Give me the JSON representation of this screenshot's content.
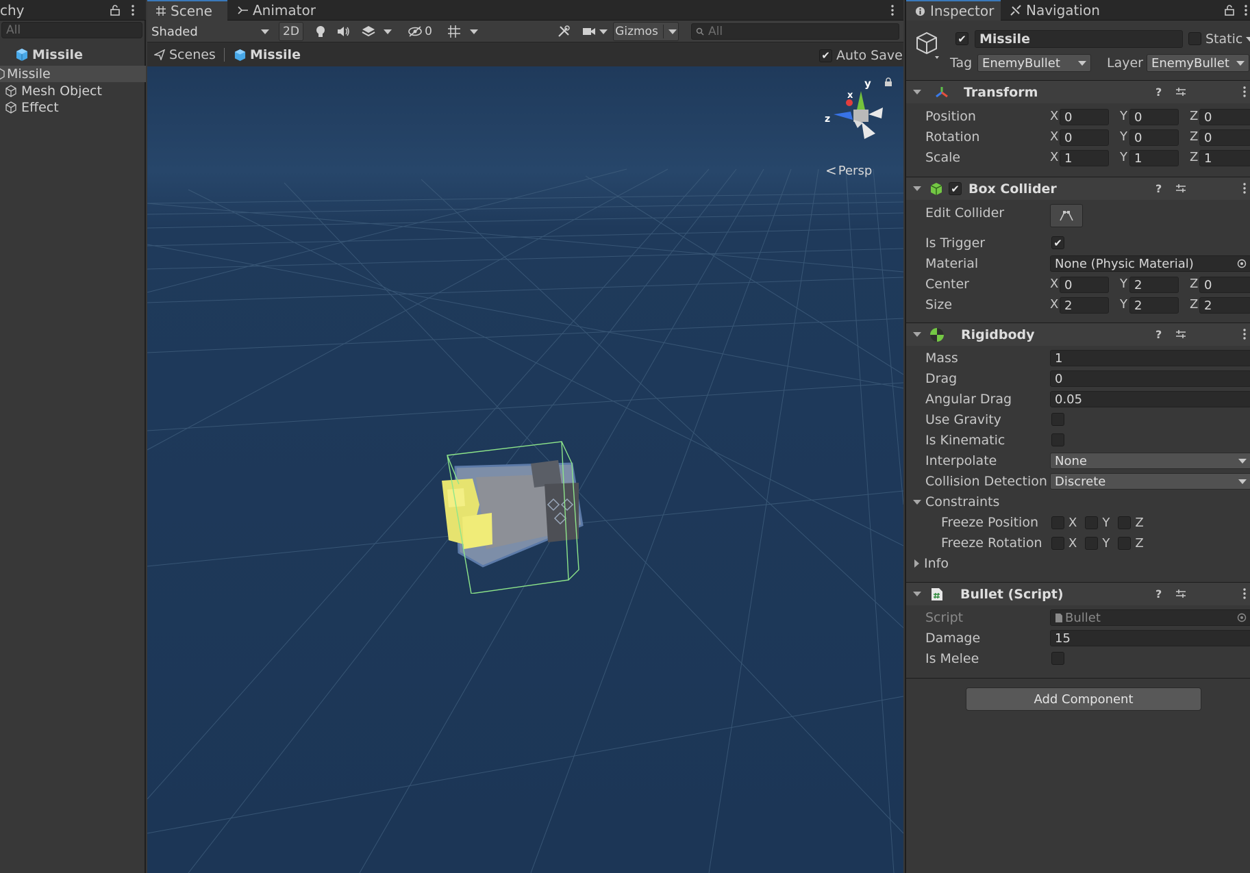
{
  "hierarchy": {
    "tab_label": "chy",
    "search_placeholder": "All",
    "root": "Missile",
    "rows": [
      "Missile",
      "Mesh Object",
      "Effect"
    ]
  },
  "scene": {
    "tabs": [
      "Scene",
      "Animator"
    ],
    "toolbar": {
      "shading": "Shaded",
      "mode_2d": "2D",
      "hidden_count": "0",
      "gizmos": "Gizmos",
      "search_placeholder": "All"
    },
    "breadcrumb": [
      "Scenes",
      "Missile"
    ],
    "auto_save": "Auto Save",
    "projection": "Persp",
    "gizmo_axes": [
      "y",
      "x",
      "z"
    ]
  },
  "inspector": {
    "tabs": [
      "Inspector",
      "Navigation"
    ],
    "object": {
      "name": "Missile",
      "static_label": "Static",
      "tag_label": "Tag",
      "tag": "EnemyBullet",
      "layer_label": "Layer",
      "layer": "EnemyBullet"
    },
    "transform": {
      "title": "Transform",
      "rows": [
        {
          "label": "Position",
          "x": "0",
          "y": "0",
          "z": "0"
        },
        {
          "label": "Rotation",
          "x": "0",
          "y": "0",
          "z": "0"
        },
        {
          "label": "Scale",
          "x": "1",
          "y": "1",
          "z": "1"
        }
      ]
    },
    "box_collider": {
      "title": "Box Collider",
      "edit_label": "Edit Collider",
      "is_trigger_label": "Is Trigger",
      "material_label": "Material",
      "material": "None (Physic Material)",
      "rows": [
        {
          "label": "Center",
          "x": "0",
          "y": "2",
          "z": "0"
        },
        {
          "label": "Size",
          "x": "2",
          "y": "2",
          "z": "2"
        }
      ]
    },
    "rigidbody": {
      "title": "Rigidbody",
      "mass_label": "Mass",
      "mass": "1",
      "drag_label": "Drag",
      "drag": "0",
      "angular_drag_label": "Angular Drag",
      "angular_drag": "0.05",
      "use_gravity_label": "Use Gravity",
      "is_kinematic_label": "Is Kinematic",
      "interpolate_label": "Interpolate",
      "interpolate": "None",
      "collision_label": "Collision Detection",
      "collision": "Discrete",
      "constraints_label": "Constraints",
      "freeze_position_label": "Freeze Position",
      "freeze_rotation_label": "Freeze Rotation",
      "info_label": "Info"
    },
    "bullet": {
      "title": "Bullet (Script)",
      "script_label": "Script",
      "script": "Bullet",
      "damage_label": "Damage",
      "damage": "15",
      "is_melee_label": "Is Melee"
    },
    "add_component": "Add Component"
  },
  "axes": [
    "X",
    "Y",
    "Z"
  ]
}
